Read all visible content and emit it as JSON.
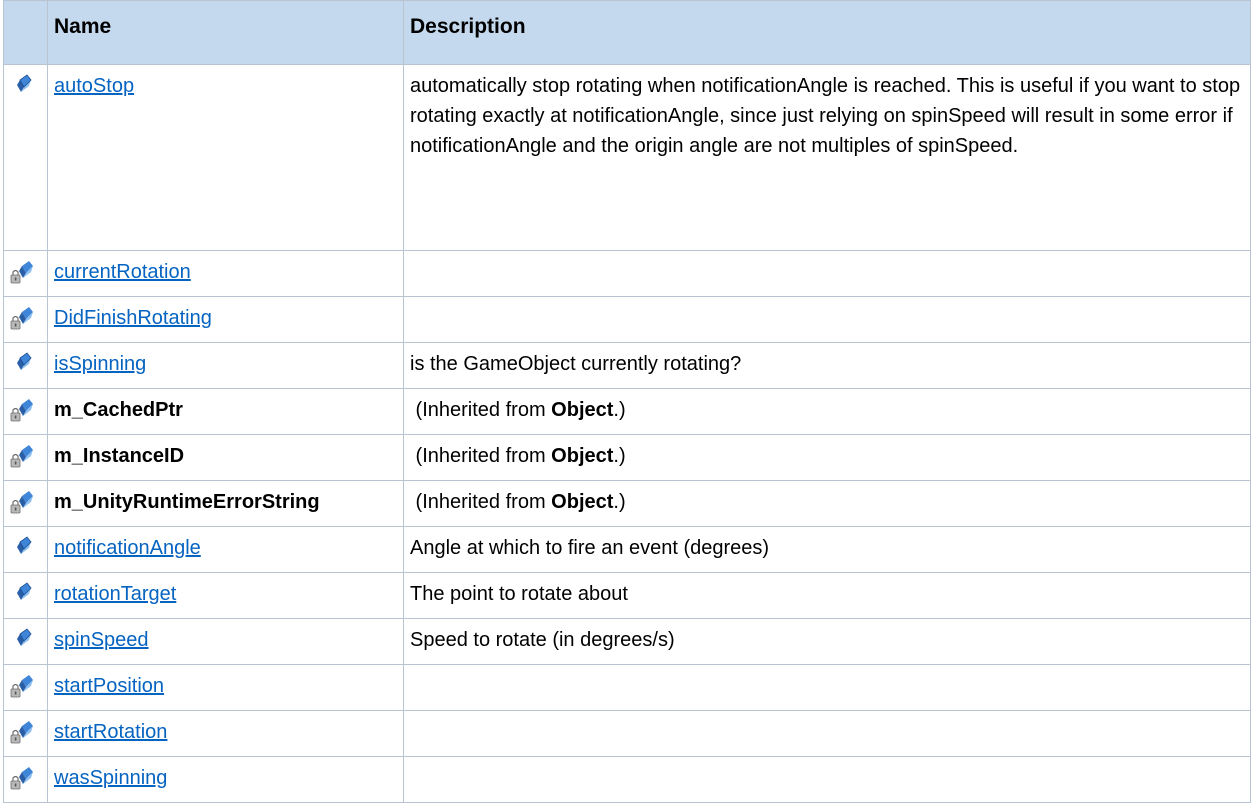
{
  "table": {
    "headers": {
      "name": "Name",
      "description": "Description"
    },
    "rows": [
      {
        "icon": "public-field-icon",
        "name": "autoStop",
        "link": true,
        "description": "automatically stop rotating when notificationAngle is reached. This is useful if you want to stop rotating exactly at notificationAngle, since just relying on spinSpeed will result in some error if notificationAngle and the origin angle are not multiples of spinSpeed."
      },
      {
        "icon": "protected-field-icon",
        "name": "currentRotation",
        "link": true,
        "description": ""
      },
      {
        "icon": "protected-field-icon",
        "name": "DidFinishRotating",
        "link": true,
        "description": ""
      },
      {
        "icon": "public-field-icon",
        "name": "isSpinning",
        "link": true,
        "description": "is the GameObject currently rotating?"
      },
      {
        "icon": "protected-field-icon",
        "name": "m_CachedPtr",
        "link": false,
        "description_prefix": "(Inherited from ",
        "description_bold": "Object",
        "description_suffix": ".)"
      },
      {
        "icon": "protected-field-icon",
        "name": "m_InstanceID",
        "link": false,
        "description_prefix": "(Inherited from ",
        "description_bold": "Object",
        "description_suffix": ".)"
      },
      {
        "icon": "protected-field-icon",
        "name": "m_UnityRuntimeErrorString",
        "link": false,
        "description_prefix": "(Inherited from ",
        "description_bold": "Object",
        "description_suffix": ".)"
      },
      {
        "icon": "public-field-icon",
        "name": "notificationAngle",
        "link": true,
        "description": "Angle at which to fire an event (degrees)"
      },
      {
        "icon": "public-field-icon",
        "name": "rotationTarget",
        "link": true,
        "description": "The point to rotate about"
      },
      {
        "icon": "public-field-icon",
        "name": "spinSpeed",
        "link": true,
        "description": "Speed to rotate (in degrees/s)"
      },
      {
        "icon": "protected-field-icon",
        "name": "startPosition",
        "link": true,
        "description": ""
      },
      {
        "icon": "protected-field-icon",
        "name": "startRotation",
        "link": true,
        "description": ""
      },
      {
        "icon": "protected-field-icon",
        "name": "wasSpinning",
        "link": true,
        "description": ""
      }
    ]
  }
}
